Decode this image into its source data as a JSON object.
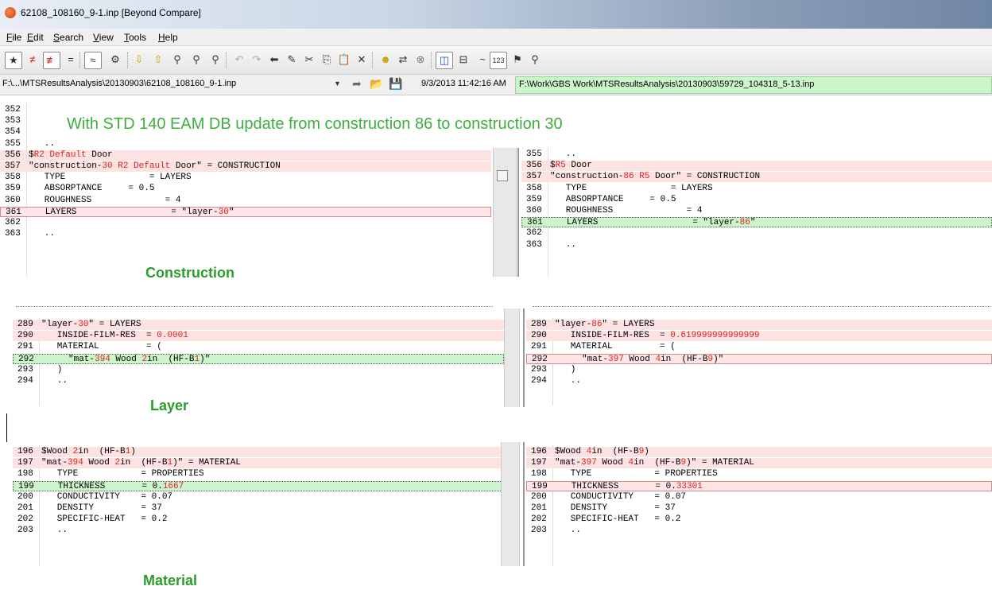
{
  "window": {
    "title": "62108_108160_9-1.inp  [Beyond Compare]"
  },
  "menu": [
    "File",
    "Edit",
    "Search",
    "View",
    "Tools",
    "Help"
  ],
  "toolbar": {
    "icons": [
      "all-files-icon",
      "not-equal-icon",
      "diff-only-icon",
      "equal-icon",
      "rules-icon",
      "session-icon",
      "next-diff-icon",
      "prev-diff-icon",
      "find-icon",
      "find-next-icon",
      "replace-icon",
      "undo-icon",
      "redo-icon",
      "back-icon",
      "edit-icon",
      "cut-icon",
      "copy-icon",
      "paste-icon",
      "delete-icon",
      "smiley-icon",
      "swap-icon",
      "stop-icon",
      "side-by-side-icon",
      "over-under-icon",
      "tilde-icon",
      "numbers-icon",
      "bookmark-icon",
      "zoom-icon"
    ]
  },
  "paths": {
    "left": "F:\\...\\MTSResultsAnalysis\\20130903\\62108_108160_9-1.inp",
    "left_time": "9/3/2013 11:42:16 AM",
    "right": "F:\\Work\\GBS Work\\MTSResultsAnalysis\\20130903\\59729_104318_5-13.inp"
  },
  "annotations": {
    "headline": "With STD 140 EAM DB update  from construction 86 to construction 30",
    "construction": "Construction",
    "layer": "Layer",
    "material": "Material"
  },
  "construction_left": {
    "lines": [
      {
        "n": "352",
        "t": ""
      },
      {
        "n": "353",
        "t": ""
      },
      {
        "n": "354",
        "t": ""
      },
      {
        "n": "355",
        "t": "   .."
      },
      {
        "n": "356",
        "t": "$R2 Default Door"
      },
      {
        "n": "357",
        "t": "\"construction-30 R2 Default Door\" = CONSTRUCTION"
      },
      {
        "n": "358",
        "t": "   TYPE                = LAYERS"
      },
      {
        "n": "359",
        "t": "   ABSORPTANCE     = 0.5"
      },
      {
        "n": "360",
        "t": "   ROUGHNESS              = 4"
      },
      {
        "n": "361",
        "t": "   LAYERS                  = \"layer-30\""
      },
      {
        "n": "362",
        "t": ""
      },
      {
        "n": "363",
        "t": "   .."
      }
    ]
  },
  "construction_right": {
    "lines": [
      {
        "n": "355",
        "t": "   .."
      },
      {
        "n": "356",
        "t": "$R5 Door"
      },
      {
        "n": "357",
        "t": "\"construction-86 R5 Door\" = CONSTRUCTION"
      },
      {
        "n": "358",
        "t": "   TYPE                = LAYERS"
      },
      {
        "n": "359",
        "t": "   ABSORPTANCE     = 0.5"
      },
      {
        "n": "360",
        "t": "   ROUGHNESS              = 4"
      },
      {
        "n": "361",
        "t": "   LAYERS                  = \"layer-86\""
      },
      {
        "n": "362",
        "t": ""
      },
      {
        "n": "363",
        "t": "   .."
      }
    ]
  },
  "layer_left": {
    "lines": [
      {
        "n": "289",
        "t": "\"layer-30\" = LAYERS"
      },
      {
        "n": "290",
        "t": "   INSIDE-FILM-RES  = 0.0001"
      },
      {
        "n": "291",
        "t": "   MATERIAL         = ("
      },
      {
        "n": "292",
        "t": "     \"mat-394 Wood 2in  (HF-B1)\""
      },
      {
        "n": "293",
        "t": "   )"
      },
      {
        "n": "294",
        "t": "   .."
      }
    ]
  },
  "layer_right": {
    "lines": [
      {
        "n": "289",
        "t": "\"layer-86\" = LAYERS"
      },
      {
        "n": "290",
        "t": "   INSIDE-FILM-RES  = 0.619999999999999"
      },
      {
        "n": "291",
        "t": "   MATERIAL         = ("
      },
      {
        "n": "292",
        "t": "     \"mat-397 Wood 4in  (HF-B9)\""
      },
      {
        "n": "293",
        "t": "   )"
      },
      {
        "n": "294",
        "t": "   .."
      }
    ]
  },
  "material_left": {
    "lines": [
      {
        "n": "196",
        "t": "$Wood 2in  (HF-B1)"
      },
      {
        "n": "197",
        "t": "\"mat-394 Wood 2in  (HF-B1)\" = MATERIAL"
      },
      {
        "n": "198",
        "t": "   TYPE            = PROPERTIES"
      },
      {
        "n": "199",
        "t": "   THICKNESS       = 0.1667"
      },
      {
        "n": "200",
        "t": "   CONDUCTIVITY    = 0.07"
      },
      {
        "n": "201",
        "t": "   DENSITY         = 37"
      },
      {
        "n": "202",
        "t": "   SPECIFIC-HEAT   = 0.2"
      },
      {
        "n": "203",
        "t": "   .."
      }
    ]
  },
  "material_right": {
    "lines": [
      {
        "n": "196",
        "t": "$Wood 4in  (HF-B9)"
      },
      {
        "n": "197",
        "t": "\"mat-397 Wood 4in  (HF-B9)\" = MATERIAL"
      },
      {
        "n": "198",
        "t": "   TYPE            = PROPERTIES"
      },
      {
        "n": "199",
        "t": "   THICKNESS       = 0.33301"
      },
      {
        "n": "200",
        "t": "   CONDUCTIVITY    = 0.07"
      },
      {
        "n": "201",
        "t": "   DENSITY         = 37"
      },
      {
        "n": "202",
        "t": "   SPECIFIC-HEAT   = 0.2"
      },
      {
        "n": "203",
        "t": "   .."
      }
    ]
  }
}
